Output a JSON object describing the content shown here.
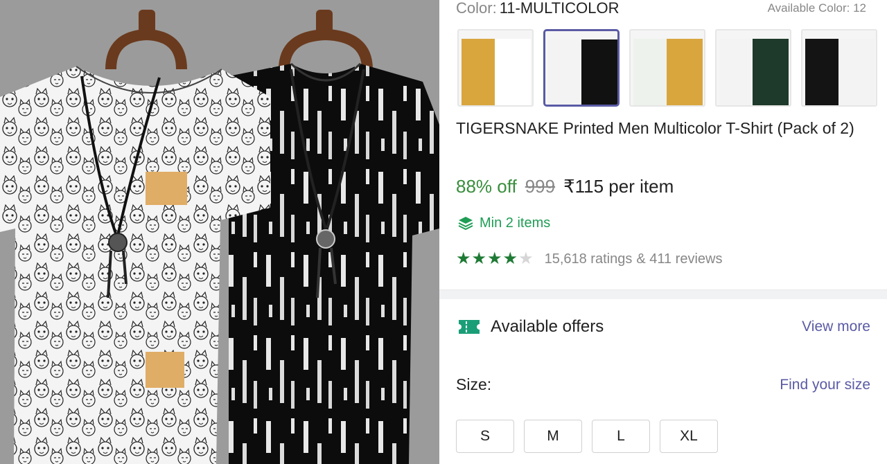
{
  "product_image": {
    "alt": ""
  },
  "color": {
    "label": "Color:",
    "value": "11-MULTICOLOR",
    "available": "Available Color: 12",
    "swatches": [
      {
        "id": "1",
        "colors": [
          "#d9a63e",
          "#ffffff"
        ],
        "selected": false
      },
      {
        "id": "2",
        "colors": [
          "#f3f3f3",
          "#111111"
        ],
        "selected": true
      },
      {
        "id": "3",
        "colors": [
          "#eef2ec",
          "#d9a63e"
        ],
        "selected": false
      },
      {
        "id": "4",
        "colors": [
          "#f3f3f3",
          "#1e3a2a"
        ],
        "selected": false
      },
      {
        "id": "5",
        "colors": [
          "#141414",
          "#f3f3f3"
        ],
        "selected": false
      }
    ]
  },
  "title": "TIGERSNAKE Printed Men Multicolor T-Shirt (Pack of 2)",
  "pricing": {
    "discount": "88% off",
    "mrp": "999",
    "price": "₹115 per item"
  },
  "min_items": "Min 2 items",
  "rating": {
    "stars": 4,
    "ratings": "15,618 ratings",
    "reviews": "& 411 reviews"
  },
  "offers": {
    "title": "Available offers",
    "view_more": "View more"
  },
  "size": {
    "label": "Size:",
    "find_size": "Find your size",
    "options": [
      "S",
      "M",
      "L",
      "XL"
    ]
  },
  "colors": {
    "accent": "#5a5aa5",
    "green": "#388e3c",
    "star_green": "#1e7a34",
    "muted": "#878787"
  },
  "icons": {
    "layers": "layers-icon",
    "ticket": "ticket-icon",
    "star": "star-icon"
  }
}
